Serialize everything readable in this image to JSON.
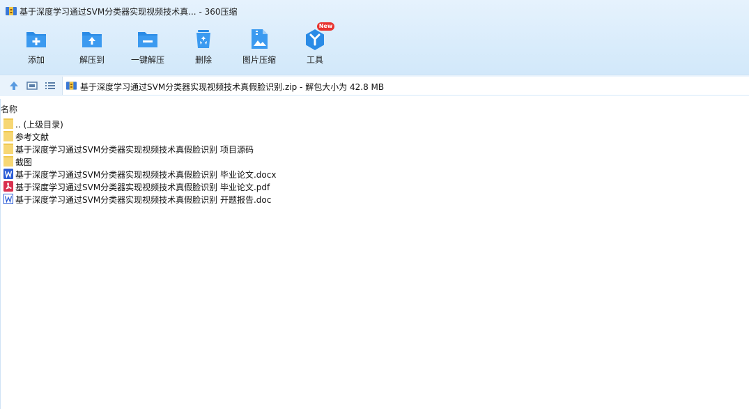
{
  "window": {
    "title": "基于深度学习通过SVM分类器实现视频技术真... - 360压缩"
  },
  "toolbar": {
    "add_label": "添加",
    "extract_to_label": "解压到",
    "one_click_extract_label": "一键解压",
    "delete_label": "删除",
    "image_compress_label": "图片压缩",
    "tools_label": "工具",
    "tools_badge": "New"
  },
  "address": {
    "path_text": "基于深度学习通过SVM分类器实现视频技术真假脸识别.zip - 解包大小为 42.8 MB"
  },
  "list": {
    "column_name": "名称",
    "rows": [
      {
        "name": ".. (上级目录)",
        "type": "folder"
      },
      {
        "name": "参考文献",
        "type": "folder"
      },
      {
        "name": "基于深度学习通过SVM分类器实现视频技术真假脸识别 项目源码",
        "type": "folder"
      },
      {
        "name": "截图",
        "type": "folder"
      },
      {
        "name": "基于深度学习通过SVM分类器实现视频技术真假脸识别 毕业论文.docx",
        "type": "word"
      },
      {
        "name": "基于深度学习通过SVM分类器实现视频技术真假脸识别 毕业论文.pdf",
        "type": "pdf"
      },
      {
        "name": "基于深度学习通过SVM分类器实现视频技术真假脸识别 开题报告.doc",
        "type": "word-doc"
      }
    ]
  },
  "colors": {
    "accent_blue": "#2a8be6",
    "folder_yellow": "#f7d774",
    "word_blue": "#2b5cd6",
    "pdf_red": "#d9304f",
    "badge_red": "#e8332f"
  },
  "icons": {
    "add": "add-archive-icon",
    "extract_to": "extract-to-icon",
    "one_click_extract": "one-click-extract-icon",
    "delete": "recycle-bin-icon",
    "image_compress": "image-compress-icon",
    "tools": "tools-icon",
    "up": "up-arrow-icon",
    "view_thumb": "thumbnail-view-icon",
    "view_list": "list-view-icon"
  }
}
